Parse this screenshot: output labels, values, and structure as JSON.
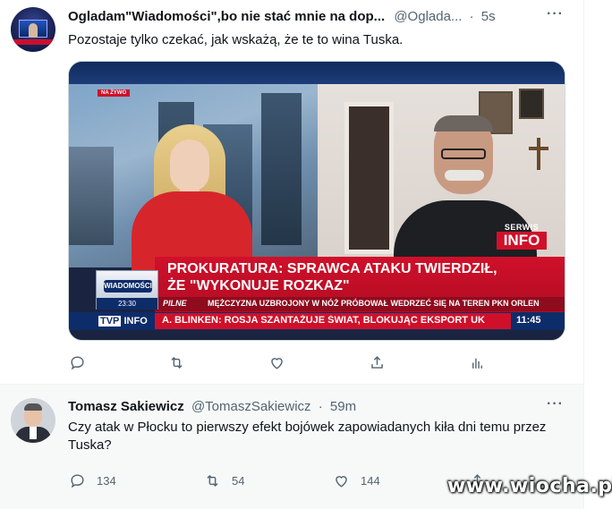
{
  "tweet1": {
    "display_name": "Ogladam\"Wiadomości\",bo nie stać mnie na dop...",
    "handle": "@Oglada...",
    "time": "5s",
    "more": "···",
    "text": "Pozostaje tylko czekać, jak wskażą, że te to wina Tuska.",
    "media": {
      "live_badge": "NA ŻYWO",
      "headline_line1": "PROKURATURA: SPRAWCA ATAKU TWIERDZIŁ,",
      "headline_line2": "ŻE \"WYKONUJE ROZKAZ\"",
      "pilne_label": "PILNE",
      "pilne_text": "MĘŻCZYZNA UZBROJONY W NÓŻ PRÓBOWAŁ WEDRZEĆ SIĘ NA TEREN PKN ORLEN",
      "ticker_text": "A. BLINKEN: ROSJA SZANTAŻUJE ŚWIAT, BLOKUJĄC EKSPORT UK",
      "ticker_time": "11:45",
      "channel_tv": "TVP",
      "channel_info": "INFO",
      "program_logo": "WIADOMOŚCI",
      "program_clock": "23:30",
      "serwis_top": "SERWIS",
      "serwis_bottom": "INFO"
    }
  },
  "tweet2": {
    "display_name": "Tomasz Sakiewicz",
    "handle": "@TomaszSakiewicz",
    "time": "59m",
    "more": "···",
    "text": "Czy atak w Płocku to pierwszy efekt bojówek zapowiadanych kiła dni temu przez Tuska?",
    "replies": "134",
    "retweets": "54",
    "likes": "144"
  },
  "watermark": "www.wiocha.pl"
}
